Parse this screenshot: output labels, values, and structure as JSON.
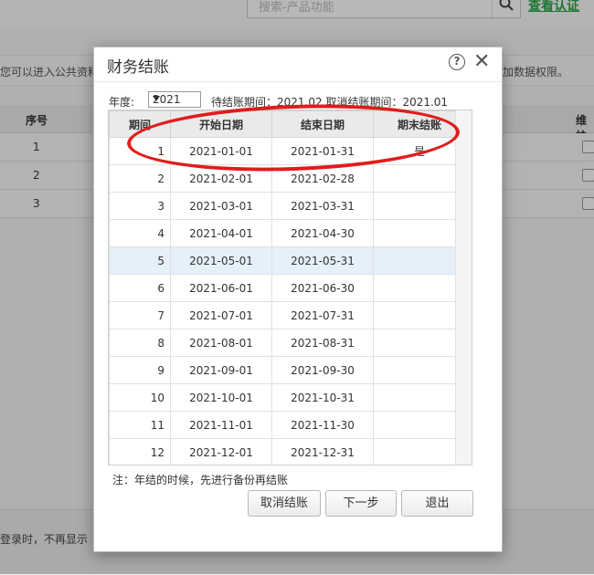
{
  "background": {
    "search_placeholder": "搜索-产品功能",
    "view_cert_link": "查看认证",
    "hint_left": "您可以进入公共资料",
    "hint_right": "加数据权限。",
    "table": {
      "col_index": "序号",
      "col_maintain": "维护",
      "rows": [
        "1",
        "2",
        "3"
      ]
    },
    "footer_text": "登录时，不再显示"
  },
  "dialog": {
    "title": "财务结账",
    "year_label": "年度:",
    "year_value": "2021",
    "period_info": "待结账期间：2021.02   取消结账期间：2021.01",
    "columns": [
      "期间",
      "开始日期",
      "结束日期",
      "期末结账"
    ],
    "rows": [
      {
        "period": "1",
        "start": "2021-01-01",
        "end": "2021-01-31",
        "closed": "是"
      },
      {
        "period": "2",
        "start": "2021-02-01",
        "end": "2021-02-28",
        "closed": ""
      },
      {
        "period": "3",
        "start": "2021-03-01",
        "end": "2021-03-31",
        "closed": ""
      },
      {
        "period": "4",
        "start": "2021-04-01",
        "end": "2021-04-30",
        "closed": ""
      },
      {
        "period": "5",
        "start": "2021-05-01",
        "end": "2021-05-31",
        "closed": ""
      },
      {
        "period": "6",
        "start": "2021-06-01",
        "end": "2021-06-30",
        "closed": ""
      },
      {
        "period": "7",
        "start": "2021-07-01",
        "end": "2021-07-31",
        "closed": ""
      },
      {
        "period": "8",
        "start": "2021-08-01",
        "end": "2021-08-31",
        "closed": ""
      },
      {
        "period": "9",
        "start": "2021-09-01",
        "end": "2021-09-30",
        "closed": ""
      },
      {
        "period": "10",
        "start": "2021-10-01",
        "end": "2021-10-31",
        "closed": ""
      },
      {
        "period": "11",
        "start": "2021-11-01",
        "end": "2021-11-30",
        "closed": ""
      },
      {
        "period": "12",
        "start": "2021-12-01",
        "end": "2021-12-31",
        "closed": ""
      }
    ],
    "selected_row_index": 4,
    "note": "注：年结的时候，先进行备份再结账",
    "buttons": {
      "cancel_close": "取消结账",
      "next": "下一步",
      "exit": "退出"
    }
  },
  "colors": {
    "annotation_ellipse": "#e21b1b",
    "selected_row": "#e6f0fb",
    "link": "#2aa64a"
  }
}
